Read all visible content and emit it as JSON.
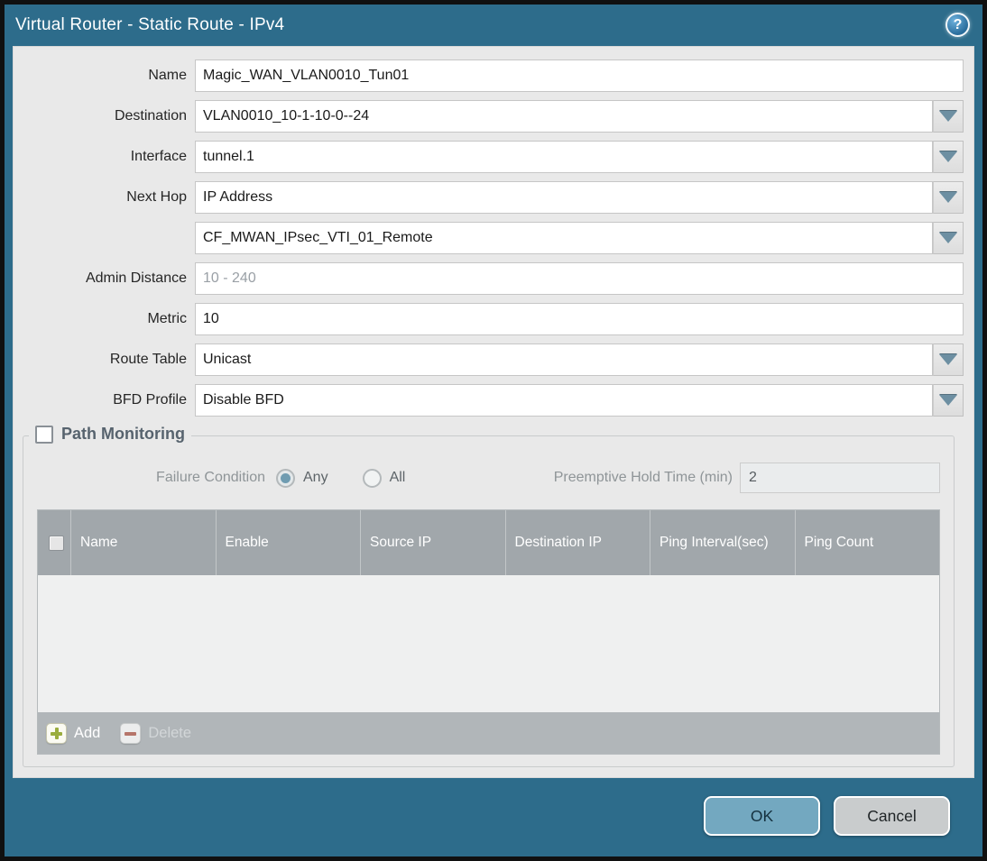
{
  "titlebar": {
    "title": "Virtual Router - Static Route - IPv4",
    "help_glyph": "?"
  },
  "form": {
    "name": {
      "label": "Name",
      "value": "Magic_WAN_VLAN0010_Tun01"
    },
    "destination": {
      "label": "Destination",
      "value": "VLAN0010_10-1-10-0--24"
    },
    "interface": {
      "label": "Interface",
      "value": "tunnel.1"
    },
    "next_hop": {
      "label": "Next Hop",
      "value": "IP Address"
    },
    "next_hop_address": {
      "value": "CF_MWAN_IPsec_VTI_01_Remote"
    },
    "admin_distance": {
      "label": "Admin Distance",
      "placeholder": "10 - 240",
      "value": ""
    },
    "metric": {
      "label": "Metric",
      "value": "10"
    },
    "route_table": {
      "label": "Route Table",
      "value": "Unicast"
    },
    "bfd_profile": {
      "label": "BFD Profile",
      "value": "Disable BFD"
    }
  },
  "path_monitoring": {
    "title": "Path Monitoring",
    "enabled": false,
    "failure_condition": {
      "label": "Failure Condition",
      "options": [
        "Any",
        "All"
      ],
      "selected": "Any"
    },
    "preemptive_hold_time": {
      "label": "Preemptive Hold Time (min)",
      "value": "2"
    },
    "table": {
      "columns": [
        "Name",
        "Enable",
        "Source IP",
        "Destination IP",
        "Ping Interval(sec)",
        "Ping Count"
      ],
      "rows": []
    },
    "actions": {
      "add": "Add",
      "delete": "Delete"
    }
  },
  "footer": {
    "ok": "OK",
    "cancel": "Cancel"
  },
  "colors": {
    "titlebar": "#2d6c8b",
    "body_bg": "#e9e9e9",
    "table_header_bg": "#a1a7ab",
    "ok_button": "#73a8c0",
    "cancel_button": "#c9cccd",
    "add_plus": "#9aad3e",
    "delete_minus": "#b5756a",
    "radio_dot": "#6f9cb1",
    "dropdown_arrow": "#6d8fa2"
  }
}
